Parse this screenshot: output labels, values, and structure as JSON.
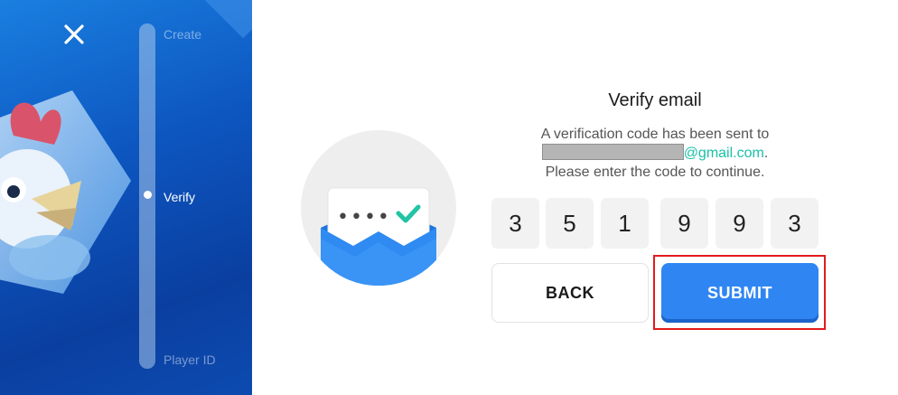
{
  "sidebar": {
    "steps": [
      {
        "label": "Create",
        "state": "inactive"
      },
      {
        "label": "Verify",
        "state": "active"
      },
      {
        "label": "Player ID",
        "state": "inactive"
      }
    ],
    "close_icon": "close-icon",
    "colors": {
      "panel": "#0d56c0",
      "track": "#aac8eb"
    }
  },
  "verify": {
    "title": "Verify email",
    "line1": "A verification code has been sent to",
    "email_domain": "@gmail.com",
    "email_suffix": ".",
    "line3": "Please enter the code to continue.",
    "code": [
      "3",
      "5",
      "1",
      "9",
      "9",
      "3"
    ],
    "back_label": "BACK",
    "submit_label": "SUBMIT",
    "colors": {
      "accent": "#2f86f2",
      "email": "#1bc0a8",
      "highlight": "#e11b1b"
    }
  },
  "illustration": {
    "icon": "envelope-check-icon",
    "masked_code": "••••"
  }
}
